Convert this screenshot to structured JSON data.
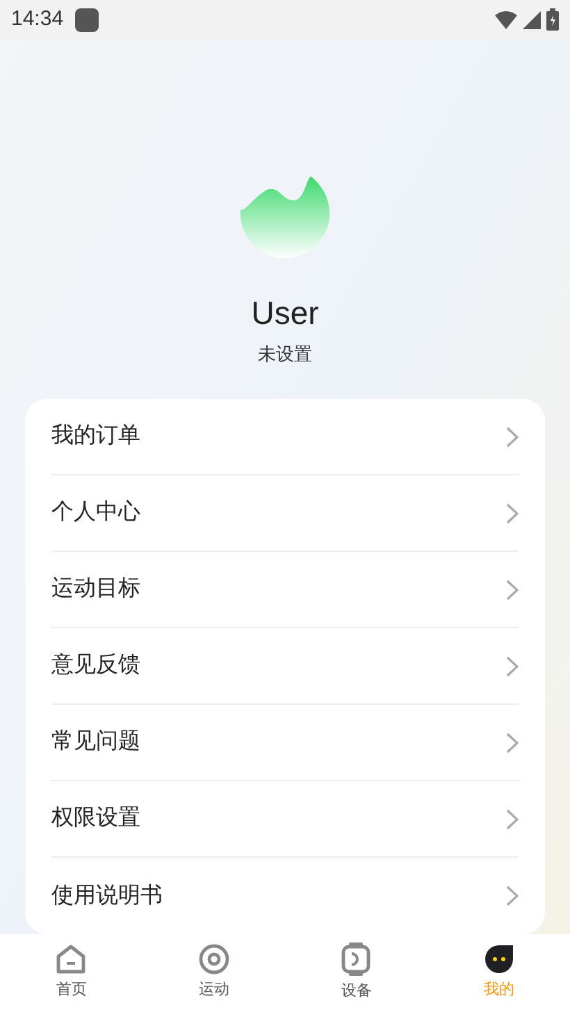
{
  "status_bar": {
    "time": "14:34"
  },
  "profile": {
    "name": "User",
    "subtitle": "未设置"
  },
  "menu": [
    {
      "label": "我的订单"
    },
    {
      "label": "个人中心"
    },
    {
      "label": "运动目标"
    },
    {
      "label": "意见反馈"
    },
    {
      "label": "常见问题"
    },
    {
      "label": "权限设置"
    },
    {
      "label": "使用说明书"
    }
  ],
  "tabs": [
    {
      "label": "首页",
      "kind": "home",
      "selected": false
    },
    {
      "label": "运动",
      "kind": "sport",
      "selected": false
    },
    {
      "label": "设备",
      "kind": "device",
      "selected": false
    },
    {
      "label": "我的",
      "kind": "mine",
      "selected": true
    }
  ]
}
